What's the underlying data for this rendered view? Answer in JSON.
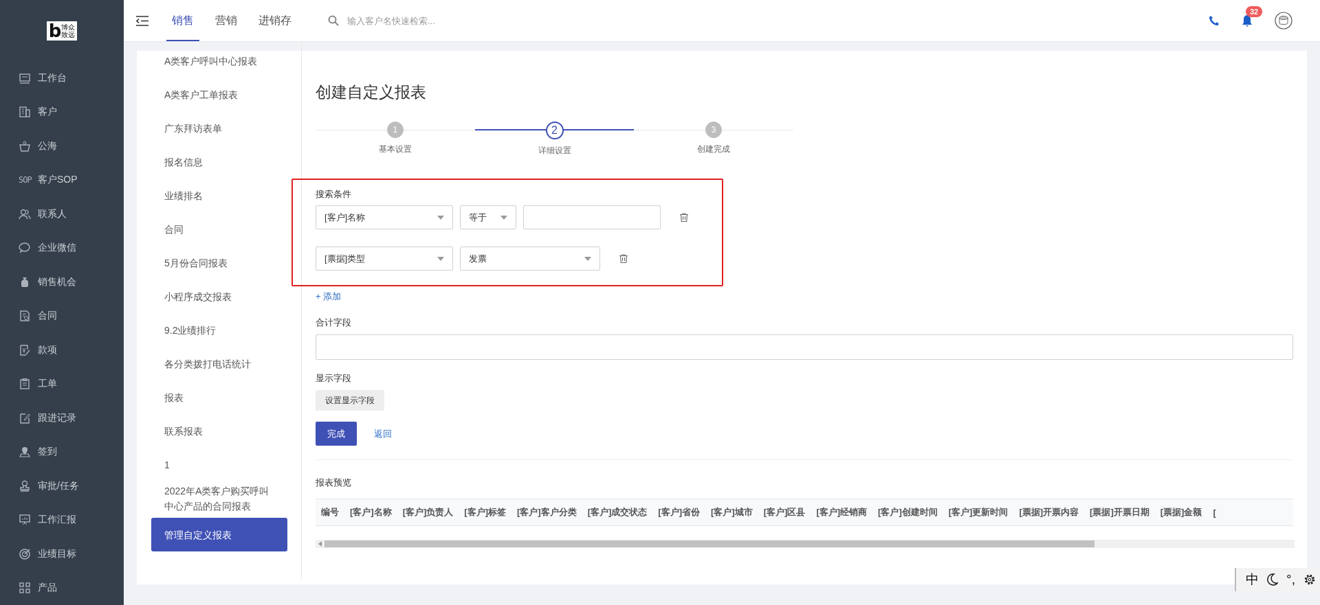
{
  "logo": {
    "mark": "b",
    "lines": [
      "博众",
      "致远"
    ]
  },
  "sidebar": {
    "items": [
      {
        "label": "工作台"
      },
      {
        "label": "客户"
      },
      {
        "label": "公海"
      },
      {
        "label": "客户SOP",
        "icon_text": "SOP"
      },
      {
        "label": "联系人"
      },
      {
        "label": "企业微信"
      },
      {
        "label": "销售机会"
      },
      {
        "label": "合同"
      },
      {
        "label": "款项"
      },
      {
        "label": "工单"
      },
      {
        "label": "跟进记录"
      },
      {
        "label": "签到"
      },
      {
        "label": "审批/任务"
      },
      {
        "label": "工作汇报"
      },
      {
        "label": "业绩目标"
      },
      {
        "label": "产品"
      }
    ]
  },
  "topbar": {
    "tabs": [
      {
        "label": "销售",
        "selected": true
      },
      {
        "label": "营销",
        "selected": false
      },
      {
        "label": "进销存",
        "selected": false
      }
    ],
    "search": {
      "placeholder": "输入客户名快速检索..."
    },
    "notifications": {
      "count": "32"
    }
  },
  "report_list": {
    "items": [
      {
        "label": "A类客户呼叫中心报表",
        "selected": false
      },
      {
        "label": "A类客户工单报表",
        "selected": false
      },
      {
        "label": "广东拜访表单",
        "selected": false
      },
      {
        "label": "报名信息",
        "selected": false
      },
      {
        "label": "业绩排名",
        "selected": false
      },
      {
        "label": "合同",
        "selected": false
      },
      {
        "label": "5月份合同报表",
        "selected": false
      },
      {
        "label": "小程序成交报表",
        "selected": false
      },
      {
        "label": "9.2业绩排行",
        "selected": false
      },
      {
        "label": "各分类拨打电话统计",
        "selected": false
      },
      {
        "label": "报表",
        "selected": false
      },
      {
        "label": "联系报表",
        "selected": false
      },
      {
        "label": "1",
        "selected": false
      },
      {
        "label": "2022年A类客户购买呼叫中心产品的合同报表",
        "selected": false
      },
      {
        "label": "管理自定义报表",
        "selected": true
      }
    ]
  },
  "form": {
    "title": "创建自定义报表",
    "steps": [
      {
        "number": "1",
        "label": "基本设置",
        "selected": false
      },
      {
        "number": "2",
        "label": "详细设置",
        "selected": true
      },
      {
        "number": "3",
        "label": "创建完成",
        "selected": false
      }
    ],
    "search_conditions": {
      "label": "搜索条件",
      "rows": [
        {
          "field": "[客户]名称",
          "operator": "等于",
          "kind": "text"
        },
        {
          "field": "[票据]类型",
          "value": "发票",
          "kind": "select"
        }
      ],
      "add_link": "+ 添加"
    },
    "sum_fields": {
      "label": "合计字段"
    },
    "display_fields": {
      "label": "显示字段",
      "button": "设置显示字段"
    },
    "buttons": {
      "submit": "完成",
      "back": "返回"
    }
  },
  "preview": {
    "label": "报表预览",
    "columns": [
      "编号",
      "[客户]名称",
      "[客户]负责人",
      "[客户]标签",
      "[客户]客户分类",
      "[客户]成交状态",
      "[客户]省份",
      "[客户]城市",
      "[客户]区县",
      "[客户]经销商",
      "[客户]创建时间",
      "[客户]更新时间",
      "[票据]开票内容",
      "[票据]开票日期",
      "[票据]金额",
      "["
    ]
  },
  "ime_toolbar": {
    "mode": "中",
    "punctuation": "°,"
  }
}
